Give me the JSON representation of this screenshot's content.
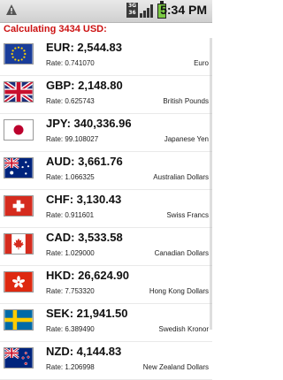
{
  "status_bar": {
    "network_top": "3G",
    "network_bottom": "36",
    "time": "5:34 PM"
  },
  "header": {
    "title": "Calculating 3434 USD:"
  },
  "rows": [
    {
      "code": "EUR",
      "amount_text": "EUR: 2,544.83",
      "rate": "Rate: 0.741070",
      "name": "Euro",
      "flag_icon": "eu-flag-icon"
    },
    {
      "code": "GBP",
      "amount_text": "GBP: 2,148.80",
      "rate": "Rate: 0.625743",
      "name": "British Pounds",
      "flag_icon": "uk-flag-icon"
    },
    {
      "code": "JPY",
      "amount_text": "JPY: 340,336.96",
      "rate": "Rate: 99.108027",
      "name": "Japanese Yen",
      "flag_icon": "japan-flag-icon"
    },
    {
      "code": "AUD",
      "amount_text": "AUD: 3,661.76",
      "rate": "Rate: 1.066325",
      "name": "Australian Dollars",
      "flag_icon": "australia-flag-icon"
    },
    {
      "code": "CHF",
      "amount_text": "CHF: 3,130.43",
      "rate": "Rate: 0.911601",
      "name": "Swiss Francs",
      "flag_icon": "switzerland-flag-icon"
    },
    {
      "code": "CAD",
      "amount_text": "CAD: 3,533.58",
      "rate": "Rate: 1.029000",
      "name": "Canadian Dollars",
      "flag_icon": "canada-flag-icon"
    },
    {
      "code": "HKD",
      "amount_text": "HKD: 26,624.90",
      "rate": "Rate: 7.753320",
      "name": "Hong Kong Dollars",
      "flag_icon": "hongkong-flag-icon"
    },
    {
      "code": "SEK",
      "amount_text": "SEK: 21,941.50",
      "rate": "Rate: 6.389490",
      "name": "Swedish Kronor",
      "flag_icon": "sweden-flag-icon"
    },
    {
      "code": "NZD",
      "amount_text": "NZD: 4,144.83",
      "rate": "Rate: 1.206998",
      "name": "New Zealand Dollars",
      "flag_icon": "newzealand-flag-icon"
    }
  ],
  "colors": {
    "header_red": "#cc1111"
  }
}
